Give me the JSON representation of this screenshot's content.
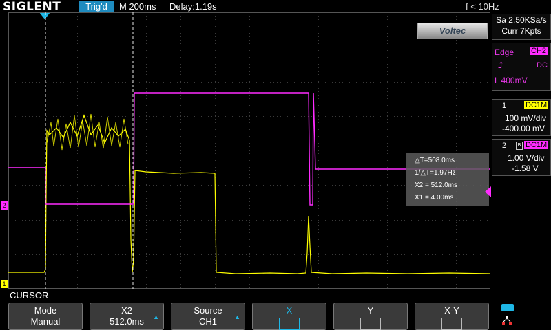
{
  "header": {
    "logo": "SIGLENT",
    "trigger_status": "Trig'd",
    "timebase": "M 200ms",
    "delay": "Delay:1.19s",
    "frequency": "f < 10Hz"
  },
  "acquisition": {
    "sample_rate": "Sa 2.50KSa/s",
    "memory": "Curr 7Kpts"
  },
  "watermark": "Voltec",
  "trigger": {
    "type": "Edge",
    "source": "CH2",
    "coupling": "DC",
    "level": "L  400mV"
  },
  "channels": [
    {
      "num": "1",
      "coupling": "DC1M",
      "scale": "100 mV/div",
      "offset": "-400.00 mV",
      "color": "#ffff00"
    },
    {
      "num": "2",
      "coupling": "DC1M",
      "scale": "1.00 V/div",
      "offset": "-1.58 V",
      "color": "#ff2cff"
    }
  ],
  "cursor_readout": {
    "delta_t": "△T=508.0ms",
    "inv_delta_t": "1/△T=1.97Hz",
    "x2": "X2 = 512.0ms",
    "x1": "X1 = 4.00ms"
  },
  "menu": {
    "title": "CURSOR",
    "softkeys": [
      {
        "l1": "Mode",
        "l2": "Manual"
      },
      {
        "l1": "X2",
        "l2": "512.0ms"
      },
      {
        "l1": "Source",
        "l2": "CH1"
      },
      {
        "l1": "X",
        "l2": ""
      },
      {
        "l1": "Y",
        "l2": ""
      },
      {
        "l1": "X-Y",
        "l2": ""
      }
    ]
  },
  "markers": {
    "ch1": "1",
    "ch2": "2"
  }
}
